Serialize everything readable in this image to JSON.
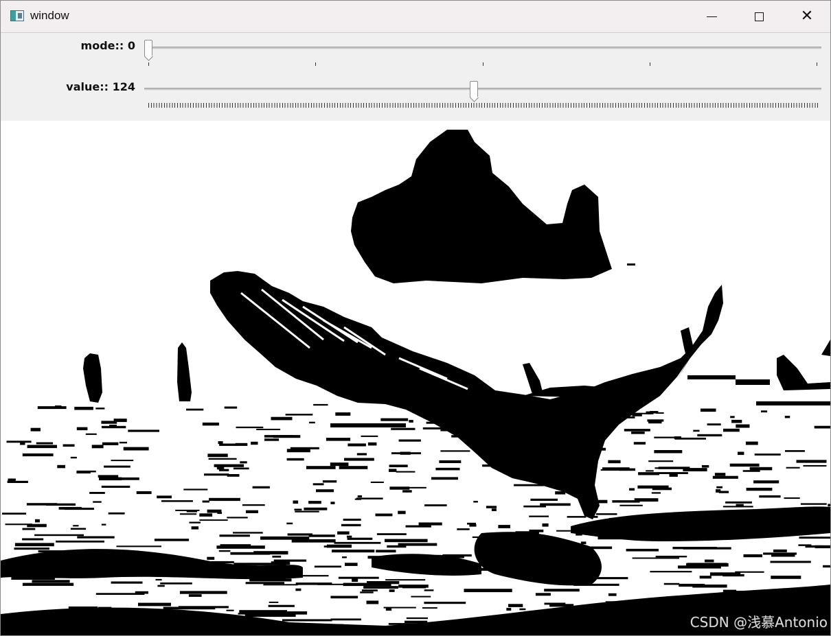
{
  "window": {
    "title": "window",
    "icon": "app-window-icon",
    "controls": [
      "minimize",
      "maximize",
      "close"
    ]
  },
  "trackbars": [
    {
      "label": "mode:: 0",
      "value": 0,
      "min": 0,
      "max": 4
    },
    {
      "label": "value:: 124",
      "value": 124,
      "min": 0,
      "max": 255
    }
  ],
  "image": {
    "content": "binary-threshold-eagle",
    "watermark": "CSDN @浅慕Antonio"
  }
}
